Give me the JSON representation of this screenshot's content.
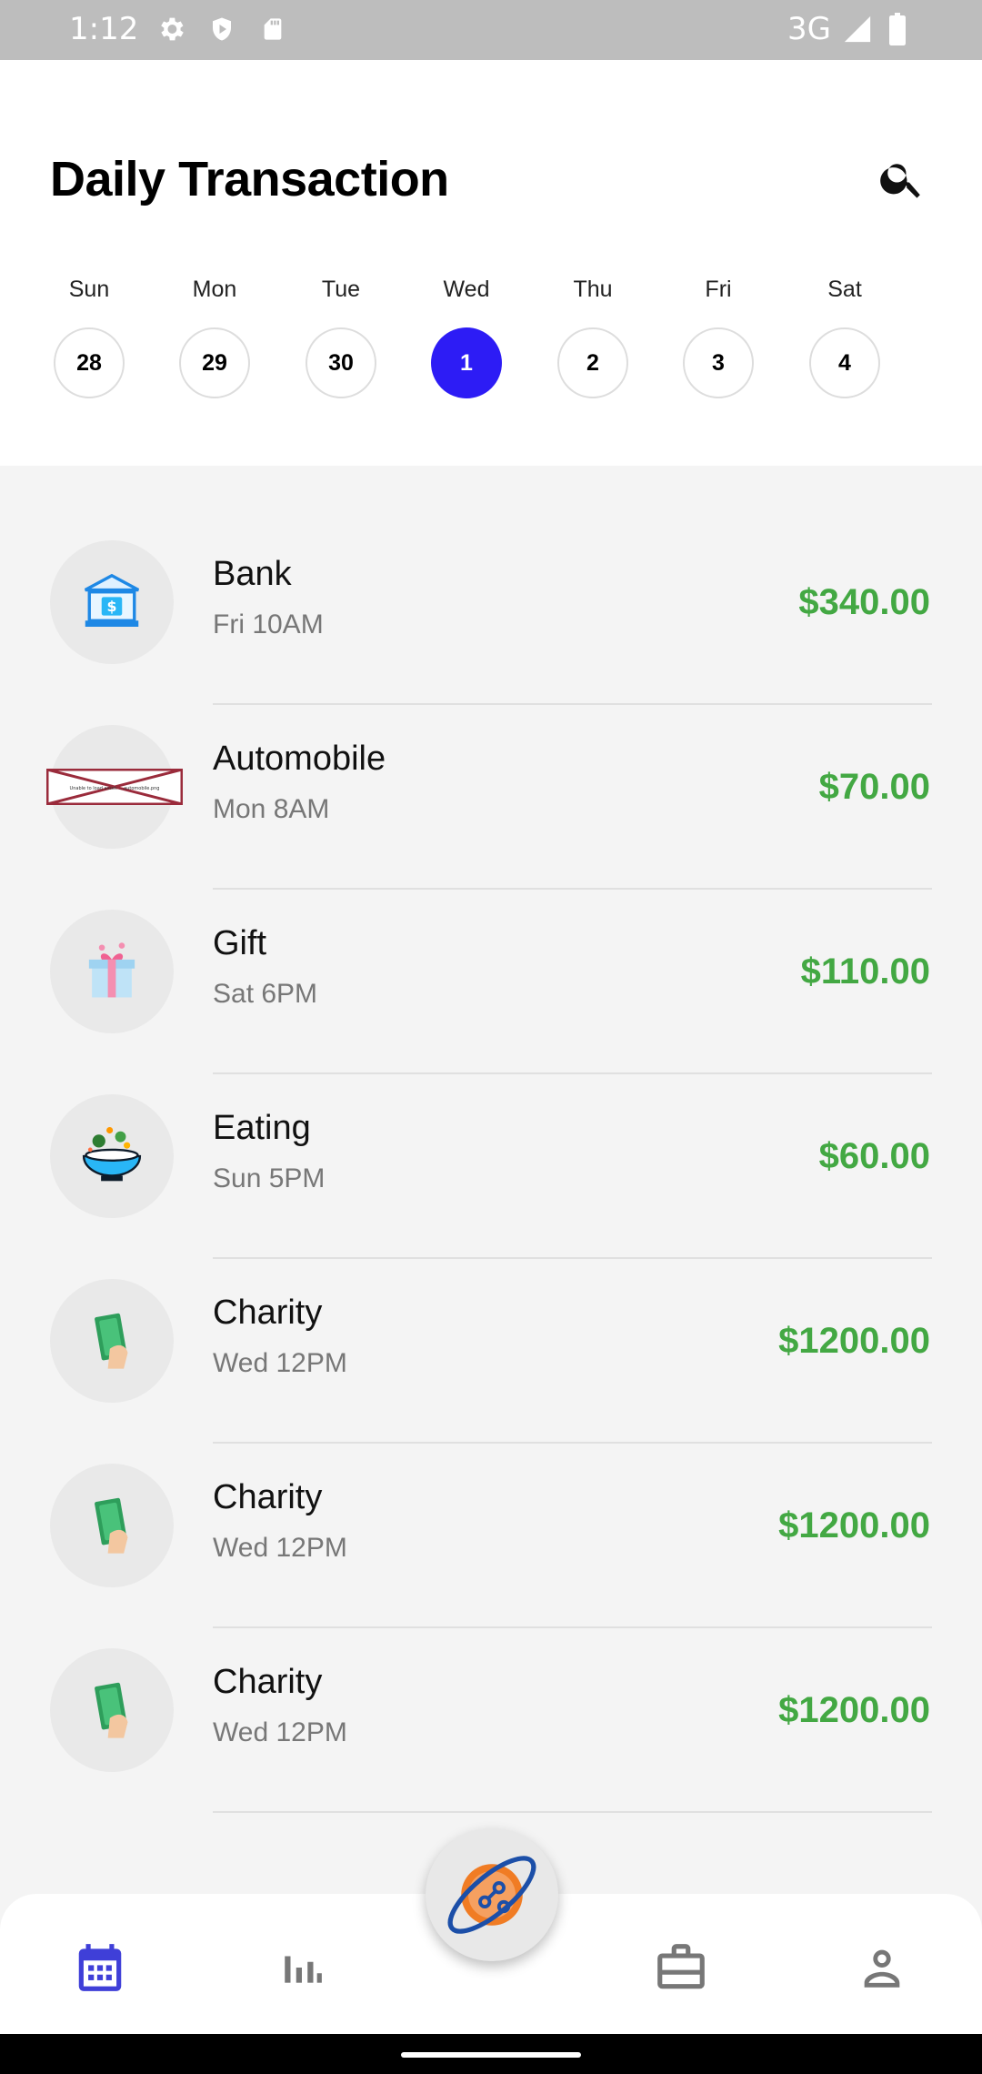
{
  "status_bar": {
    "time": "1:12",
    "network": "3G"
  },
  "header": {
    "title": "Daily Transaction"
  },
  "week": [
    {
      "name": "Sun",
      "num": "28",
      "selected": false
    },
    {
      "name": "Mon",
      "num": "29",
      "selected": false
    },
    {
      "name": "Tue",
      "num": "30",
      "selected": false
    },
    {
      "name": "Wed",
      "num": "1",
      "selected": true
    },
    {
      "name": "Thu",
      "num": "2",
      "selected": false
    },
    {
      "name": "Fri",
      "num": "3",
      "selected": false
    },
    {
      "name": "Sat",
      "num": "4",
      "selected": false
    }
  ],
  "transactions": [
    {
      "name": "Bank",
      "when": "Fri 10AM",
      "amount": "$340.00",
      "icon": "bank-icon"
    },
    {
      "name": "Automobile",
      "when": "Mon 8AM",
      "amount": "$70.00",
      "icon": "broken-image-icon",
      "broken_image_text": "Unable to load asset: …automobile.png"
    },
    {
      "name": "Gift",
      "when": "Sat 6PM",
      "amount": "$110.00",
      "icon": "gift-icon"
    },
    {
      "name": "Eating",
      "when": "Sun 5PM",
      "amount": "$60.00",
      "icon": "food-bowl-icon"
    },
    {
      "name": "Charity",
      "when": "Wed 12PM",
      "amount": "$1200.00",
      "icon": "money-hand-icon"
    },
    {
      "name": "Charity",
      "when": "Wed 12PM",
      "amount": "$1200.00",
      "icon": "money-hand-icon"
    },
    {
      "name": "Charity",
      "when": "Wed 12PM",
      "amount": "$1200.00",
      "icon": "money-hand-icon"
    }
  ],
  "colors": {
    "accent": "#2d1cf5",
    "amount": "#43a843",
    "nav_active": "#3f3fd8",
    "nav_inactive": "#777777"
  },
  "nav": [
    {
      "name": "calendar",
      "icon": "calendar-icon",
      "active": true
    },
    {
      "name": "stats",
      "icon": "bar-chart-icon",
      "active": false
    },
    {
      "name": "budget",
      "icon": "briefcase-icon",
      "active": false
    },
    {
      "name": "profile",
      "icon": "person-icon",
      "active": false
    }
  ]
}
